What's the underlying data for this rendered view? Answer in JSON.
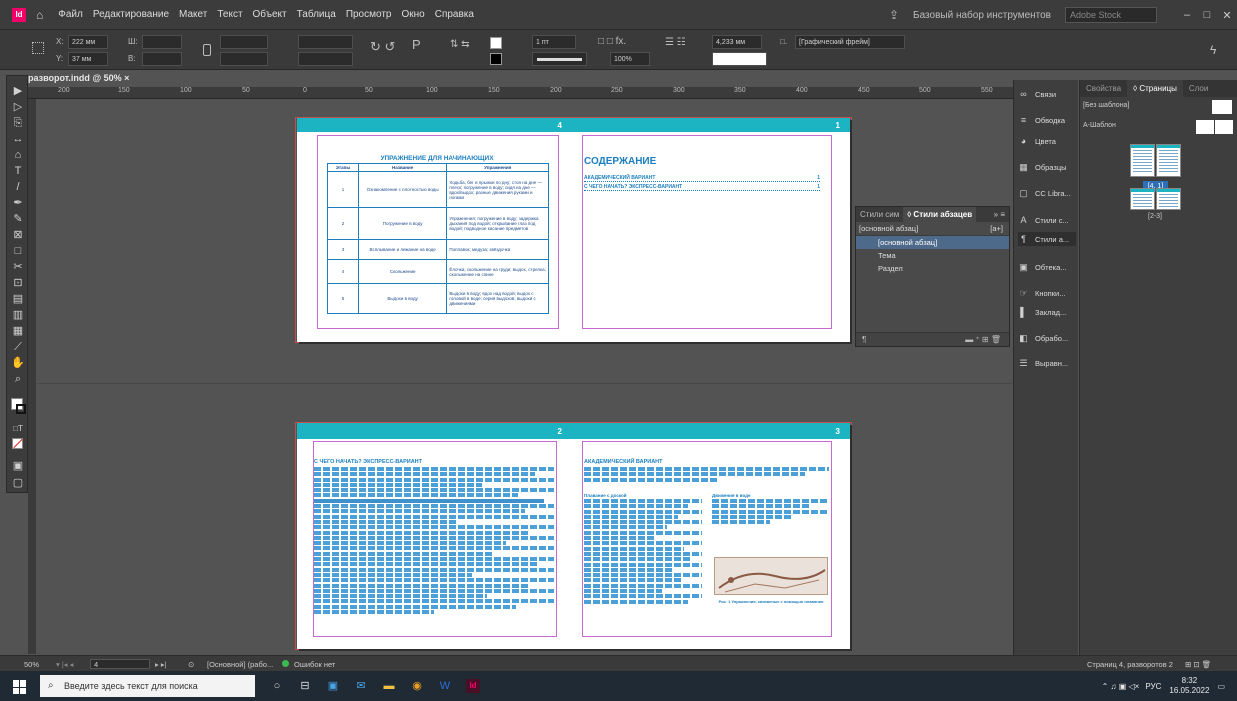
{
  "menu": {
    "app_badge": "Id",
    "items": [
      "Файл",
      "Редактирование",
      "Макет",
      "Текст",
      "Объект",
      "Таблица",
      "Просмотр",
      "Окно",
      "Справка"
    ],
    "workspace": "Базовый набор инструментов",
    "stock_search_placeholder": "Adobe Stock"
  },
  "control": {
    "x_label": "X:",
    "x_value": "222 мм",
    "y_label": "Y:",
    "y_value": "37 мм",
    "w_label": "Ш:",
    "h_label": "В:",
    "stroke_weight": "1 пт",
    "opacity": "100%",
    "size_value": "4,233 мм",
    "frame_style": "[Графический фрейм]"
  },
  "document": {
    "tab_title": "разворот.indd @ 50% ×",
    "ruler_marks": [
      "200",
      "150",
      "100",
      "50",
      "0",
      "50",
      "100",
      "150",
      "200",
      "250",
      "300",
      "350",
      "400",
      "450",
      "500",
      "550"
    ]
  },
  "pages": {
    "p4_number": "4",
    "p1_number": "1",
    "p2_number": "2",
    "p3_number": "3",
    "table_title": "УПРАЖНЕНИЕ ДЛЯ НАЧИНАЮЩИХ",
    "table_headers": [
      "Этапы",
      "Название",
      "Упражнения"
    ],
    "table_rows": [
      {
        "num": "1",
        "name": "Ознакомление с плотностью воды",
        "ex": "Ходьба, бег и прыжки по дну; стоя на дне — плеск; погружение в воду; сидя на дне — вдох/выдох; разные движения руками и ногами"
      },
      {
        "num": "2",
        "name": "Погружение в воду",
        "ex": "Упражнения; погружение в воду; задержка дыхания под водой; открывание глаз под водой; подводное касание предметов"
      },
      {
        "num": "3",
        "name": "Всплывание и лежание на воде",
        "ex": "Поплавок; медуза; звёздочка"
      },
      {
        "num": "4",
        "name": "Скольжение",
        "ex": "Ёлочка; скольжение на груди; выдох, стрелка; скольжение на спине"
      },
      {
        "num": "5",
        "name": "Выдохи в воду",
        "ex": "Выдохи в воду; вдох над водой; выдох с головой в воде; серия выдохов; выдохи с движениями"
      }
    ],
    "toc_title": "СОДЕРЖАНИЕ",
    "toc_items": [
      {
        "label": "АКАДЕМИЧЕСКИЙ ВАРИАНТ",
        "page": "1"
      },
      {
        "label": "С ЧЕГО НАЧАТЬ? ЭКСПРЕСС-ВАРИАНТ",
        "page": "1"
      }
    ],
    "p2_heading": "С ЧЕГО НАЧАТЬ? ЭКСПРЕСС-ВАРИАНТ",
    "p3_heading": "АКАДЕМИЧЕСКИЙ ВАРИАНТ",
    "p3_sub_left": "Плавание с доской",
    "p3_sub_right": "Движения в воде",
    "figure_caption": "Рис. 1 Упражнения, связанные с помощью плавания"
  },
  "styles_panel": {
    "tab_inactive": "Стили сим",
    "tab_active": "◊ Стили абзацев",
    "current_style": "[основной абзац]",
    "current_tag": "[a+]",
    "items": [
      "[основной абзац]",
      "Тема",
      "Раздел"
    ]
  },
  "dock": {
    "items": [
      "Связи",
      "Обводка",
      "Цвета",
      "Образцы",
      "CC Libra...",
      "Стили с...",
      "Стили а...",
      "Обтека...",
      "Кнопки...",
      "Заклад...",
      "Обрабо...",
      "Выравн..."
    ]
  },
  "pages_panel": {
    "tabs": [
      "Свойства",
      "◊ Страницы",
      "Слои"
    ],
    "none_master": "[Без шаблона]",
    "a_master": "А-Шаблон",
    "spread_label_1": "[4, 1]",
    "spread_label_2": "[2-3]",
    "status": "Страниц 4, разворотов 2"
  },
  "status": {
    "zoom": "50%",
    "page_field": "4",
    "style_mode": "[Основной] (рабо...",
    "preflight": "Ошибок нет"
  },
  "taskbar": {
    "search_placeholder": "Введите здесь текст для поиска",
    "lang": "РУС",
    "time": "8:32",
    "date": "16.05.2022"
  },
  "colors": {
    "accent_band": "#1cb4c2",
    "text_blue": "#1c7fc0",
    "margin_guide": "#c86bd0"
  }
}
